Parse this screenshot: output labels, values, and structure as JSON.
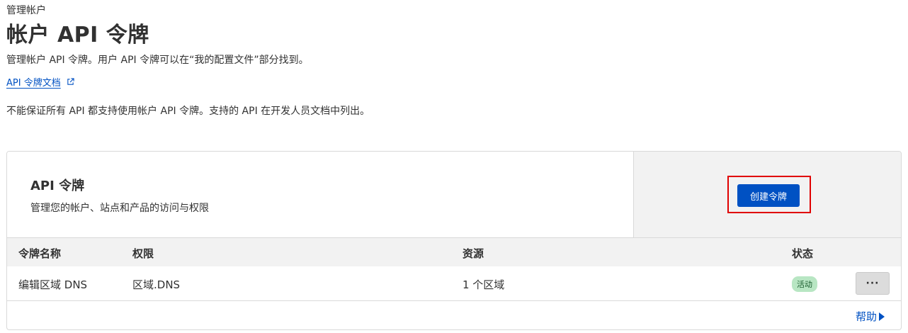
{
  "breadcrumb": "管理帐户",
  "page_title": "帐户 API 令牌",
  "description": "管理帐户 API 令牌。用户 API 令牌可以在“我的配置文件”部分找到。",
  "docs_link": {
    "label": "API 令牌文档",
    "icon": "external-link-icon"
  },
  "note": "不能保证所有 API 都支持使用帐户 API 令牌。支持的 API 在开发人员文档中列出。",
  "card": {
    "title": "API 令牌",
    "subtitle": "管理您的帐户、站点和产品的访问与权限",
    "create_button": "创建令牌"
  },
  "table": {
    "columns": [
      "令牌名称",
      "权限",
      "资源",
      "状态"
    ],
    "rows": [
      {
        "name": "编辑区域 DNS",
        "permission": "区域.DNS",
        "resources": "1 个区域",
        "status": "活动",
        "actions": "···"
      }
    ]
  },
  "help": {
    "label": "帮助",
    "icon": "caret-right-icon"
  },
  "colors": {
    "accent": "#0051c3",
    "highlight": "#e00000",
    "status_active_bg": "#b8e6c3"
  }
}
